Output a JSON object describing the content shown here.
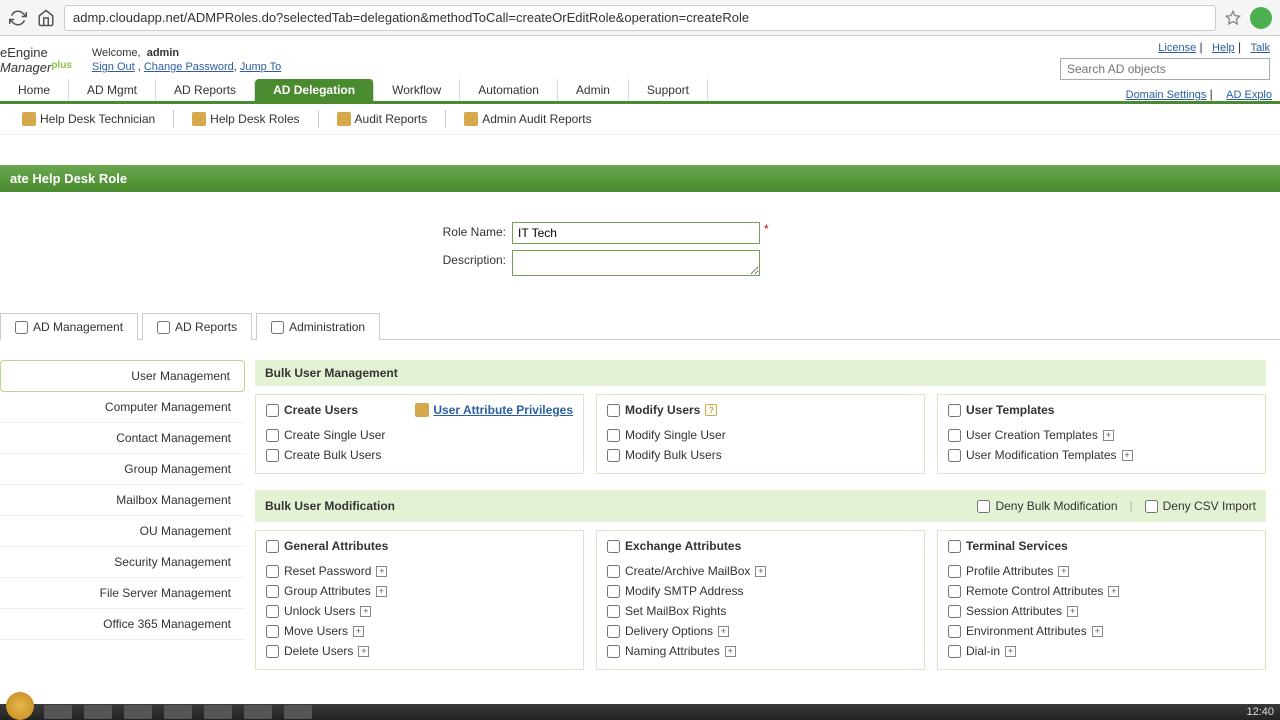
{
  "browser": {
    "url": "admp.cloudapp.net/ADMPRoles.do?selectedTab=delegation&methodToCall=createOrEditRole&operation=createRole"
  },
  "header": {
    "logo": "eEngine",
    "logo2": "Manager",
    "plus": "plus",
    "welcome": "Welcome,",
    "user": "admin",
    "signout": "Sign Out",
    "change_pw": "Change Password",
    "jump_to": "Jump To",
    "license": "License",
    "help": "Help",
    "talk": "Talk",
    "search_placeholder": "Search AD objects"
  },
  "tabs": {
    "items": [
      "Home",
      "AD Mgmt",
      "AD Reports",
      "AD Delegation",
      "Workflow",
      "Automation",
      "Admin",
      "Support"
    ],
    "active": 3,
    "domain_settings": "Domain Settings",
    "ad_explorer": "AD Explo"
  },
  "subtabs": {
    "items": [
      "Help Desk Technician",
      "Help Desk Roles",
      "Audit Reports",
      "Admin Audit Reports"
    ]
  },
  "page_title": "ate Help Desk Role",
  "form": {
    "role_name_label": "Role Name:",
    "role_name_value": "IT Tech",
    "desc_label": "Description:",
    "desc_value": ""
  },
  "cat_tabs": {
    "items": [
      "AD Management",
      "AD Reports",
      "Administration"
    ],
    "active": 0
  },
  "side_nav": {
    "items": [
      "User Management",
      "Computer Management",
      "Contact Management",
      "Group Management",
      "Mailbox Management",
      "OU Management",
      "Security Management",
      "File Server Management",
      "Office 365 Management"
    ],
    "active": 0
  },
  "sections": {
    "bulk_user_mgmt": {
      "title": "Bulk User Management",
      "create_users": {
        "title": "Create Users",
        "link": "User Attribute Privileges",
        "items": [
          "Create Single User",
          "Create Bulk Users"
        ]
      },
      "modify_users": {
        "title": "Modify Users",
        "items": [
          "Modify Single User",
          "Modify Bulk Users"
        ]
      },
      "user_templates": {
        "title": "User Templates",
        "items": [
          "User Creation Templates",
          "User Modification Templates"
        ]
      }
    },
    "bulk_user_mod": {
      "title": "Bulk User Modification",
      "deny_bulk": "Deny Bulk Modification",
      "deny_csv": "Deny CSV Import",
      "general": {
        "title": "General Attributes",
        "items": [
          "Reset Password",
          "Group Attributes",
          "Unlock Users",
          "Move Users",
          "Delete Users"
        ]
      },
      "exchange": {
        "title": "Exchange Attributes",
        "items": [
          "Create/Archive MailBox",
          "Modify SMTP Address",
          "Set MailBox Rights",
          "Delivery Options",
          "Naming Attributes"
        ]
      },
      "terminal": {
        "title": "Terminal Services",
        "items": [
          "Profile Attributes",
          "Remote Control Attributes",
          "Session Attributes",
          "Environment Attributes",
          "Dial-in"
        ]
      }
    }
  },
  "taskbar": {
    "time": "12:40"
  }
}
